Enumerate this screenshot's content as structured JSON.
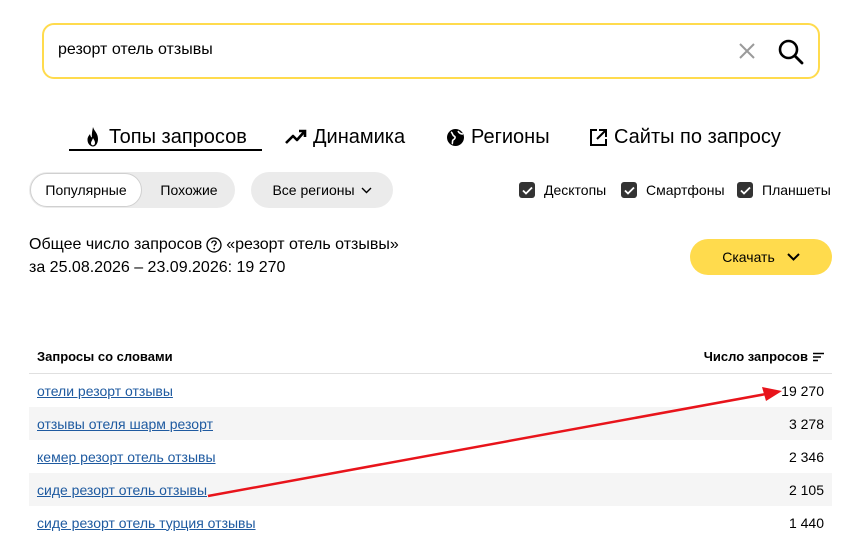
{
  "search": {
    "query": "резорт отель отзывы"
  },
  "tabs": [
    {
      "label": "Топы запросов",
      "icon": "flame-icon",
      "active": true
    },
    {
      "label": "Динамика",
      "icon": "trend-icon",
      "active": false
    },
    {
      "label": "Регионы",
      "icon": "globe-icon",
      "active": false
    },
    {
      "label": "Сайты по запросу",
      "icon": "external-link-icon",
      "active": false
    }
  ],
  "filters": {
    "segment": {
      "active": "Популярные",
      "other": "Похожие"
    },
    "region": "Все регионы",
    "devices": [
      {
        "label": "Десктопы",
        "checked": true
      },
      {
        "label": "Смартфоны",
        "checked": true
      },
      {
        "label": "Планшеты",
        "checked": true
      }
    ]
  },
  "summary": {
    "prefix": "Общее число запросов",
    "query_quoted": "«резорт отель отзывы»",
    "line2": "за 25.08.2026 – 23.09.2026: 19 270"
  },
  "download_label": "Скачать",
  "table": {
    "col_query": "Запросы со словами",
    "col_count": "Число запросов",
    "rows": [
      {
        "query": "отели резорт отзывы",
        "count": "19 270"
      },
      {
        "query": "отзывы отеля шарм резорт",
        "count": "3 278"
      },
      {
        "query": "кемер резорт отель отзывы",
        "count": "2 346"
      },
      {
        "query": "сиде резорт отель отзывы",
        "count": "2 105"
      },
      {
        "query": "сиде резорт отель турция отзывы",
        "count": "1 440"
      }
    ]
  },
  "colors": {
    "accent": "#ffdb4d",
    "link": "#1e5aa0",
    "annotation_arrow": "#e8141b"
  }
}
